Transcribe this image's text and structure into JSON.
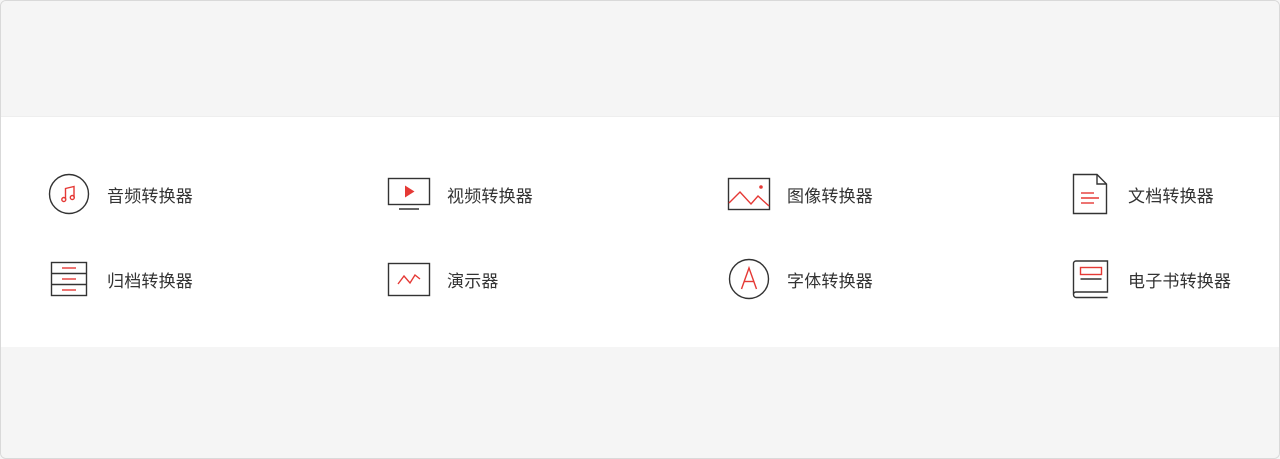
{
  "colors": {
    "accent": "#e53935",
    "outline": "#333333",
    "panel_bg": "#ffffff",
    "page_bg": "#f5f5f5"
  },
  "converters": {
    "items": [
      {
        "label": "音频转换器",
        "icon": "music-note-icon"
      },
      {
        "label": "视频转换器",
        "icon": "video-monitor-icon"
      },
      {
        "label": "图像转换器",
        "icon": "image-icon"
      },
      {
        "label": "文档转换器",
        "icon": "document-icon"
      },
      {
        "label": "归档转换器",
        "icon": "archive-icon"
      },
      {
        "label": "演示器",
        "icon": "presentation-icon"
      },
      {
        "label": "字体转换器",
        "icon": "font-icon"
      },
      {
        "label": "电子书转换器",
        "icon": "ebook-icon"
      }
    ]
  }
}
